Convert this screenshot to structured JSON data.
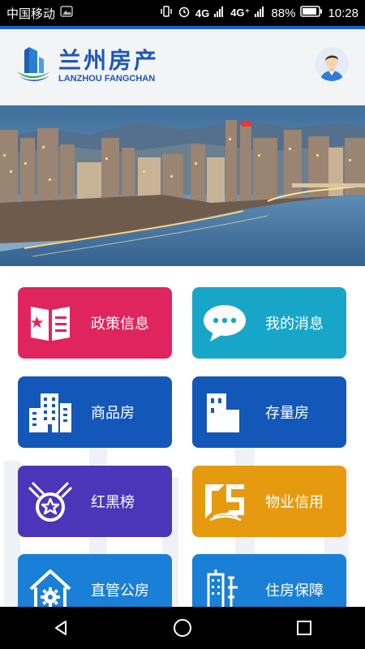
{
  "status_bar": {
    "carrier": "中国移动",
    "network_left": "4G",
    "network_right": "4G⁺",
    "battery": "88%",
    "time": "10:28"
  },
  "header": {
    "title_cn": "兰州房产",
    "title_en": "LANZHOU FANGCHAN",
    "brand_color": "#1f56b8"
  },
  "tiles": [
    {
      "label": "政策信息",
      "icon": "policy-book-icon",
      "color": "#e0245e"
    },
    {
      "label": "我的消息",
      "icon": "chat-bubble-icon",
      "color": "#18a6c8"
    },
    {
      "label": "商品房",
      "icon": "buildings-icon",
      "color": "#1358b8"
    },
    {
      "label": "存量房",
      "icon": "building-icon",
      "color": "#1358b8"
    },
    {
      "label": "红黑榜",
      "icon": "medal-star-icon",
      "color": "#4b35b8"
    },
    {
      "label": "物业信用",
      "icon": "property-credit-logo-icon",
      "color": "#e69a10"
    },
    {
      "label": "直管公房",
      "icon": "house-gear-icon",
      "color": "#1a7fd6"
    },
    {
      "label": "住房保障",
      "icon": "tower-icon",
      "color": "#1a7fd6"
    }
  ],
  "nav": {
    "back": "back-icon",
    "home": "home-icon",
    "recents": "recents-icon"
  }
}
